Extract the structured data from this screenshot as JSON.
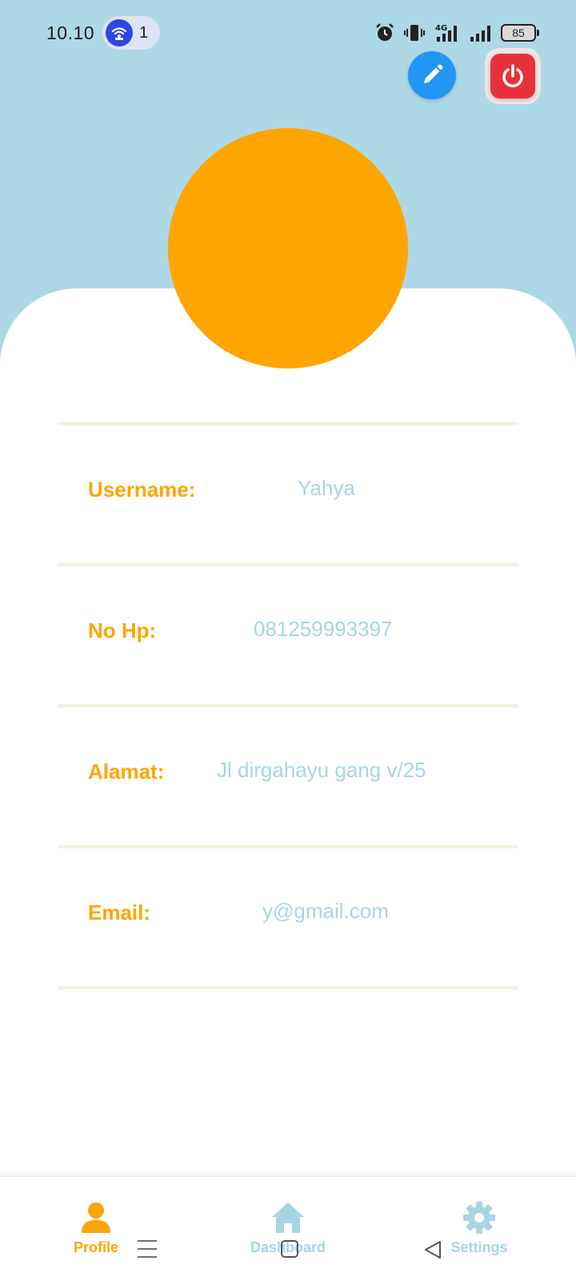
{
  "status_bar": {
    "time": "10.10",
    "hotspot_count": "1",
    "battery": "85",
    "network": "4G",
    "icons": [
      "hotspot-icon",
      "alarm-icon",
      "vibrate-icon",
      "signal-4g-icon",
      "signal-icon",
      "battery-icon"
    ]
  },
  "header": {
    "edit_icon": "pencil-icon",
    "logout_icon": "power-icon"
  },
  "profile": {
    "fields": [
      {
        "label": "Username:",
        "value": "Yahya"
      },
      {
        "label": "No Hp:",
        "value": "081259993397"
      },
      {
        "label": "Alamat:",
        "value": "Jl dirgahayu gang v/25"
      },
      {
        "label": "Email:",
        "value": "y@gmail.com"
      }
    ]
  },
  "bottom_nav": {
    "items": [
      {
        "label": "Profile",
        "icon": "person-icon",
        "active": true
      },
      {
        "label": "Dashboard",
        "icon": "home-icon",
        "active": false
      },
      {
        "label": "Settings",
        "icon": "gear-icon",
        "active": false
      }
    ]
  },
  "colors": {
    "header_bg": "#add8e6",
    "accent": "#ffa500",
    "value_text": "#a8d4e4",
    "edit_button": "#2196f3",
    "logout_button": "#e8313a",
    "nav_inactive": "#a8d4e4"
  }
}
